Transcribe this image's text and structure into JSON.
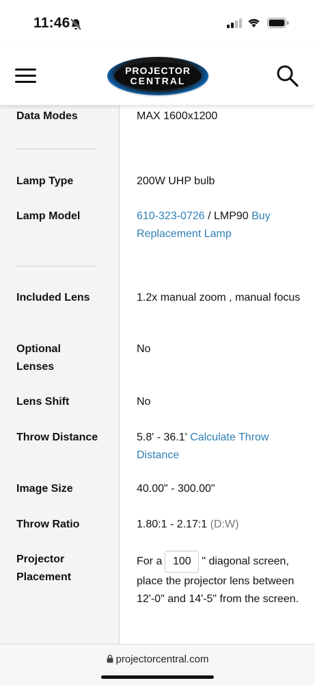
{
  "status": {
    "time": "11:46"
  },
  "header": {
    "logo_line1": "PROJECTOR",
    "logo_line2": "CENTRAL"
  },
  "specs": {
    "data_modes": {
      "label": "Data Modes",
      "value": "MAX 1600x1200"
    },
    "lamp_type": {
      "label": "Lamp Type",
      "value": "200W UHP bulb"
    },
    "lamp_model": {
      "label": "Lamp Model",
      "part_link": "610-323-0726",
      "part_sep": " / LMP90 ",
      "buy_link": "Buy Replacement Lamp"
    },
    "included_lens": {
      "label": "Included Lens",
      "value": "1.2x manual zoom , manual focus"
    },
    "optional_lenses": {
      "label": "Optional Lenses",
      "value": "No"
    },
    "lens_shift": {
      "label": "Lens Shift",
      "value": "No"
    },
    "throw_distance": {
      "label": "Throw Distance",
      "value": "5.8' - 36.1' ",
      "link": "Calculate Throw Distance"
    },
    "image_size": {
      "label": "Image Size",
      "value": "40.00\" - 300.00\""
    },
    "throw_ratio": {
      "label": "Throw Ratio",
      "value": "1.80:1 - 2.17:1 ",
      "note": "(D:W)"
    },
    "placement": {
      "label": "Projector Placement",
      "prefix": "For a",
      "screen_value": "100",
      "suffix": "\" diagonal screen, place the projector lens between 12'-0\" and 14'-5\" from the screen."
    }
  },
  "url_bar": {
    "domain": "projectorcentral.com"
  }
}
